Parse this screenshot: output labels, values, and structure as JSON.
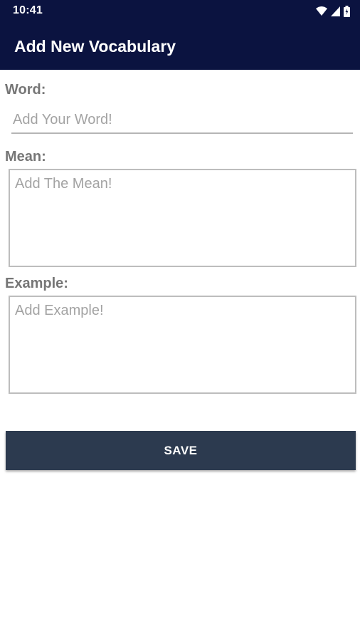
{
  "status_bar": {
    "time": "10:41",
    "icons": [
      "wifi-icon",
      "signal-icon",
      "battery-icon"
    ]
  },
  "app_bar": {
    "title": "Add New Vocabulary",
    "color": "#0b1340"
  },
  "form": {
    "word": {
      "label": "Word:",
      "value": "",
      "placeholder": "Add Your Word!"
    },
    "mean": {
      "label": "Mean:",
      "value": "",
      "placeholder": "Add The Mean!"
    },
    "example": {
      "label": "Example:",
      "value": "",
      "placeholder": "Add Example!"
    },
    "save_label": "SAVE",
    "save_color": "#2c3a4f"
  }
}
